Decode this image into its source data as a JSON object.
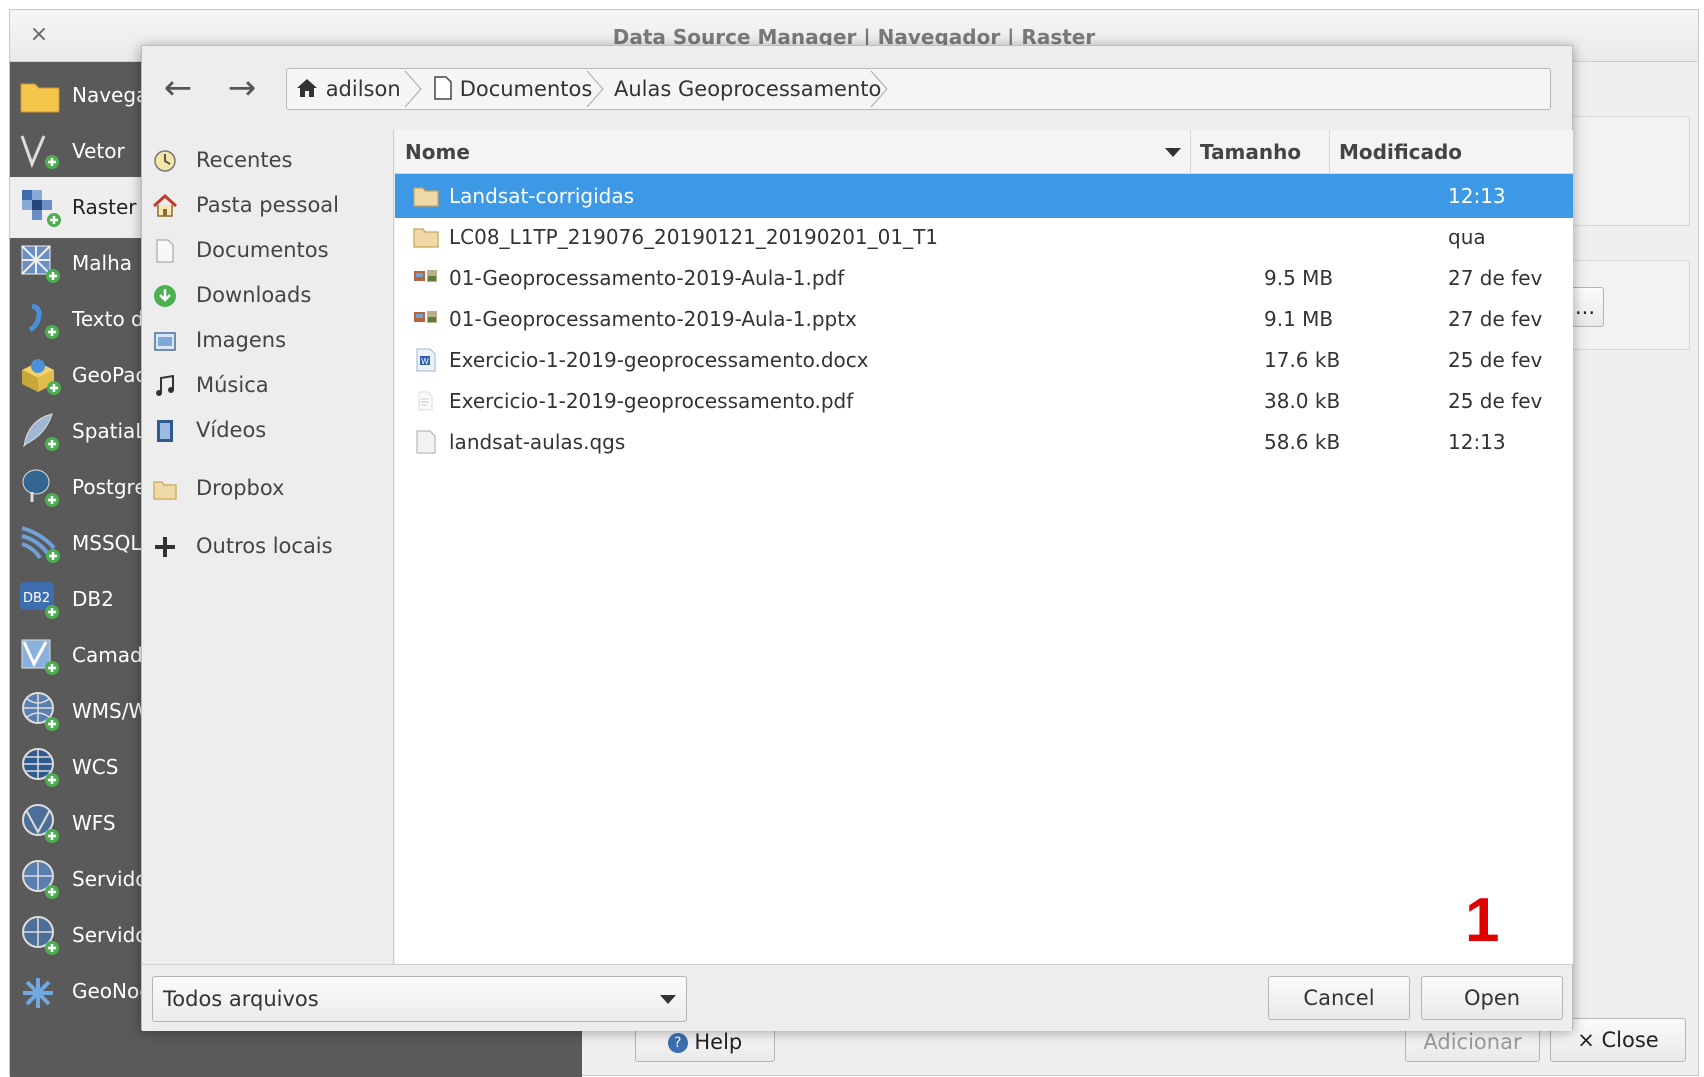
{
  "window": {
    "title": "Data Source Manager | Navegador | Raster",
    "close_glyph": "×"
  },
  "sidebar": {
    "items": [
      {
        "label": "Navegador"
      },
      {
        "label": "Vetor"
      },
      {
        "label": "Raster"
      },
      {
        "label": "Malha"
      },
      {
        "label": "Texto delimitado"
      },
      {
        "label": "GeoPackage"
      },
      {
        "label": "SpatiaLite"
      },
      {
        "label": "PostgreSQL"
      },
      {
        "label": "MSSQL"
      },
      {
        "label": "DB2"
      },
      {
        "label": "Camada virtual"
      },
      {
        "label": "WMS/WMTS"
      },
      {
        "label": "WCS"
      },
      {
        "label": "WFS"
      },
      {
        "label": "Servidor ArcGIS Map"
      },
      {
        "label": "Servidor ArcGIS Feature"
      },
      {
        "label": "GeoNode"
      }
    ]
  },
  "main_buttons": {
    "ellipsis": "...",
    "help": "Help",
    "add": "Adicionar",
    "close": "× Close"
  },
  "dialog": {
    "nav": {
      "back_glyph": "←",
      "forward_glyph": "→"
    },
    "breadcrumb": [
      "adilson",
      "Documentos",
      "Aulas Geoprocessamento"
    ],
    "places": [
      {
        "label": "Recentes",
        "icon": "recent-icon"
      },
      {
        "label": "Pasta pessoal",
        "icon": "home-icon"
      },
      {
        "label": "Documentos",
        "icon": "document-icon"
      },
      {
        "label": "Downloads",
        "icon": "download-icon"
      },
      {
        "label": "Imagens",
        "icon": "image-icon"
      },
      {
        "label": "Música",
        "icon": "music-icon"
      },
      {
        "label": "Vídeos",
        "icon": "video-icon"
      },
      {
        "label": "Dropbox",
        "icon": "folder-icon"
      },
      {
        "label": "Outros locais",
        "icon": "plus-icon"
      }
    ],
    "columns": {
      "name": "Nome",
      "size": "Tamanho",
      "modified": "Modificado"
    },
    "files": [
      {
        "name": "Landsat-corrigidas",
        "size": "",
        "modified": "12:13",
        "type": "folder",
        "selected": true
      },
      {
        "name": "LC08_L1TP_219076_20190121_20190201_01_T1",
        "size": "",
        "modified": "qua",
        "type": "folder",
        "selected": false
      },
      {
        "name": "01-Geoprocessamento-2019-Aula-1.pdf",
        "size": "9.5 MB",
        "modified": "27 de fev",
        "type": "image-doc",
        "selected": false
      },
      {
        "name": "01-Geoprocessamento-2019-Aula-1.pptx",
        "size": "9.1 MB",
        "modified": "27 de fev",
        "type": "image-doc",
        "selected": false
      },
      {
        "name": "Exercicio-1-2019-geoprocessamento.docx",
        "size": "17.6 kB",
        "modified": "25 de fev",
        "type": "word-doc",
        "selected": false
      },
      {
        "name": "Exercicio-1-2019-geoprocessamento.pdf",
        "size": "38.0 kB",
        "modified": "25 de fev",
        "type": "text-doc",
        "selected": false
      },
      {
        "name": "landsat-aulas.qgs",
        "size": "58.6 kB",
        "modified": "12:13",
        "type": "blank-doc",
        "selected": false
      }
    ],
    "filter": "Todos arquivos",
    "cancel": "Cancel",
    "open": "Open"
  },
  "annotation": "1",
  "colors": {
    "selection": "#3d98e5",
    "sidebar_bg": "#5a5a5a",
    "annotation": "#e00000"
  }
}
